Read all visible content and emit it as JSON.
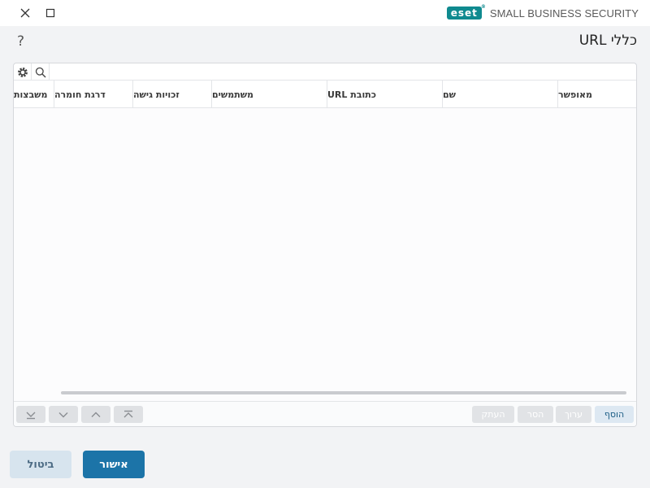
{
  "window": {
    "brand_logo": "eset",
    "brand_reg": "®",
    "product_name": "SMALL BUSINESS SECURITY",
    "brand_color": "#0f8a8f",
    "close_icon": "close-icon",
    "maximize_icon": "maximize-icon"
  },
  "header": {
    "title": "כללי URL",
    "help": "?"
  },
  "toolbar": {
    "settings_icon": "gear-icon",
    "search_icon": "search-icon"
  },
  "table": {
    "columns": [
      "מאופשר",
      "שם",
      "כתובת URL",
      "משתמשים",
      "זכויות גישה",
      "דרגת חומרה",
      "משבצות"
    ],
    "rows": []
  },
  "footer": {
    "nav_icons": [
      "move-to-bottom-icon",
      "move-down-icon",
      "move-up-icon",
      "move-to-top-icon"
    ],
    "actions": {
      "add": "הוסף",
      "edit": "ערוך",
      "remove": "הסר",
      "copy": "העתק"
    }
  },
  "dialog": {
    "ok": "אישור",
    "cancel": "ביטול",
    "accent": "#1c74a8"
  }
}
